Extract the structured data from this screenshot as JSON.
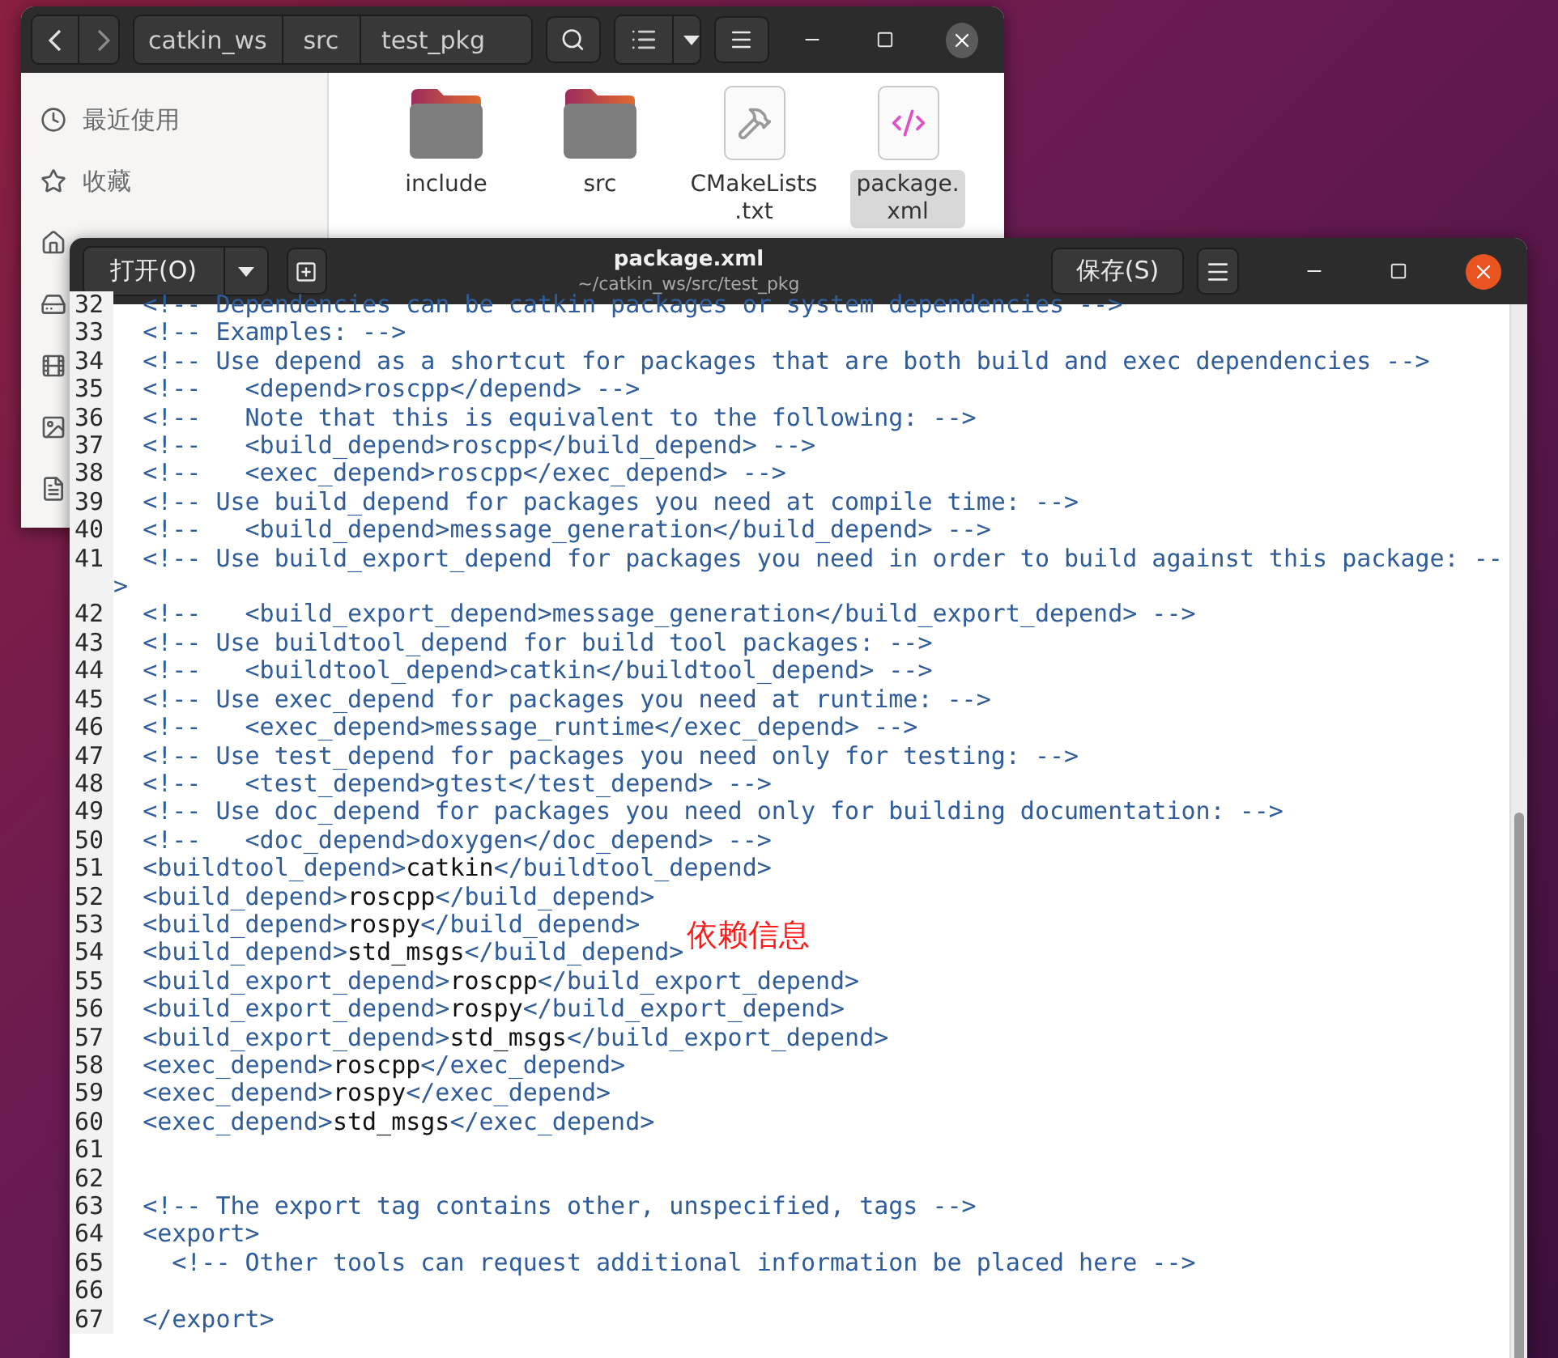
{
  "desktop": {
    "annotation": "依赖信息"
  },
  "file_manager": {
    "path": [
      {
        "label": "catkin_ws"
      },
      {
        "label": "src"
      },
      {
        "label": "test_pkg"
      }
    ],
    "sidebar": [
      {
        "label": "最近使用"
      },
      {
        "label": "收藏"
      }
    ],
    "files": [
      {
        "name": [
          "include"
        ],
        "kind": "folder",
        "selected": false
      },
      {
        "name": [
          "src"
        ],
        "kind": "folder",
        "selected": false
      },
      {
        "name": [
          "CMakeLists",
          ".txt"
        ],
        "kind": "build",
        "selected": false
      },
      {
        "name": [
          "package.",
          "xml"
        ],
        "kind": "xml",
        "selected": true
      }
    ]
  },
  "editor": {
    "open_button": "打开(O)",
    "title": "package.xml",
    "subtitle": "~/catkin_ws/src/test_pkg",
    "save_button": "保存(S)",
    "lines": [
      {
        "number": "32",
        "segments": [
          {
            "text": "  <!-- Dependencies can be catkin packages or system dependencies -->",
            "kind": "markup"
          }
        ]
      },
      {
        "number": "33",
        "segments": [
          {
            "text": "  <!-- Examples: -->",
            "kind": "markup"
          }
        ]
      },
      {
        "number": "34",
        "segments": [
          {
            "text": "  <!-- Use depend as a shortcut for packages that are both build and exec dependencies -->",
            "kind": "markup"
          }
        ]
      },
      {
        "number": "35",
        "segments": [
          {
            "text": "  <!--   <depend>roscpp</depend> -->",
            "kind": "markup"
          }
        ]
      },
      {
        "number": "36",
        "segments": [
          {
            "text": "  <!--   Note that this is equivalent to the following: -->",
            "kind": "markup"
          }
        ]
      },
      {
        "number": "37",
        "segments": [
          {
            "text": "  <!--   <build_depend>roscpp</build_depend> -->",
            "kind": "markup"
          }
        ]
      },
      {
        "number": "38",
        "segments": [
          {
            "text": "  <!--   <exec_depend>roscpp</exec_depend> -->",
            "kind": "markup"
          }
        ]
      },
      {
        "number": "39",
        "segments": [
          {
            "text": "  <!-- Use build_depend for packages you need at compile time: -->",
            "kind": "markup"
          }
        ]
      },
      {
        "number": "40",
        "segments": [
          {
            "text": "  <!--   <build_depend>message_generation</build_depend> -->",
            "kind": "markup"
          }
        ]
      },
      {
        "number": "41",
        "segments": [
          {
            "text": "  <!-- Use build_export_depend for packages you need in order to build against this package: -->",
            "kind": "markup"
          }
        ]
      },
      {
        "number": "42",
        "segments": [
          {
            "text": "  <!--   <build_export_depend>message_generation</build_export_depend> -->",
            "kind": "markup"
          }
        ]
      },
      {
        "number": "43",
        "segments": [
          {
            "text": "  <!-- Use buildtool_depend for build tool packages: -->",
            "kind": "markup"
          }
        ]
      },
      {
        "number": "44",
        "segments": [
          {
            "text": "  <!--   <buildtool_depend>catkin</buildtool_depend> -->",
            "kind": "markup"
          }
        ]
      },
      {
        "number": "45",
        "segments": [
          {
            "text": "  <!-- Use exec_depend for packages you need at runtime: -->",
            "kind": "markup"
          }
        ]
      },
      {
        "number": "46",
        "segments": [
          {
            "text": "  <!--   <exec_depend>message_runtime</exec_depend> -->",
            "kind": "markup"
          }
        ]
      },
      {
        "number": "47",
        "segments": [
          {
            "text": "  <!-- Use test_depend for packages you need only for testing: -->",
            "kind": "markup"
          }
        ]
      },
      {
        "number": "48",
        "segments": [
          {
            "text": "  <!--   <test_depend>gtest</test_depend> -->",
            "kind": "markup"
          }
        ]
      },
      {
        "number": "49",
        "segments": [
          {
            "text": "  <!-- Use doc_depend for packages you need only for building documentation: -->",
            "kind": "markup"
          }
        ]
      },
      {
        "number": "50",
        "segments": [
          {
            "text": "  <!--   <doc_depend>doxygen</doc_depend> -->",
            "kind": "markup"
          }
        ]
      },
      {
        "number": "51",
        "segments": [
          {
            "text": "  <buildtool_depend>",
            "kind": "markup"
          },
          {
            "text": "catkin",
            "kind": "text"
          },
          {
            "text": "</buildtool_depend>",
            "kind": "markup"
          }
        ]
      },
      {
        "number": "52",
        "segments": [
          {
            "text": "  <build_depend>",
            "kind": "markup"
          },
          {
            "text": "roscpp",
            "kind": "text"
          },
          {
            "text": "</build_depend>",
            "kind": "markup"
          }
        ]
      },
      {
        "number": "53",
        "segments": [
          {
            "text": "  <build_depend>",
            "kind": "markup"
          },
          {
            "text": "rospy",
            "kind": "text"
          },
          {
            "text": "</build_depend>",
            "kind": "markup"
          }
        ]
      },
      {
        "number": "54",
        "segments": [
          {
            "text": "  <build_depend>",
            "kind": "markup"
          },
          {
            "text": "std_msgs",
            "kind": "text"
          },
          {
            "text": "</build_depend>",
            "kind": "markup"
          }
        ]
      },
      {
        "number": "55",
        "segments": [
          {
            "text": "  <build_export_depend>",
            "kind": "markup"
          },
          {
            "text": "roscpp",
            "kind": "text"
          },
          {
            "text": "</build_export_depend>",
            "kind": "markup"
          }
        ]
      },
      {
        "number": "56",
        "segments": [
          {
            "text": "  <build_export_depend>",
            "kind": "markup"
          },
          {
            "text": "rospy",
            "kind": "text"
          },
          {
            "text": "</build_export_depend>",
            "kind": "markup"
          }
        ]
      },
      {
        "number": "57",
        "segments": [
          {
            "text": "  <build_export_depend>",
            "kind": "markup"
          },
          {
            "text": "std_msgs",
            "kind": "text"
          },
          {
            "text": "</build_export_depend>",
            "kind": "markup"
          }
        ]
      },
      {
        "number": "58",
        "segments": [
          {
            "text": "  <exec_depend>",
            "kind": "markup"
          },
          {
            "text": "roscpp",
            "kind": "text"
          },
          {
            "text": "</exec_depend>",
            "kind": "markup"
          }
        ]
      },
      {
        "number": "59",
        "segments": [
          {
            "text": "  <exec_depend>",
            "kind": "markup"
          },
          {
            "text": "rospy",
            "kind": "text"
          },
          {
            "text": "</exec_depend>",
            "kind": "markup"
          }
        ]
      },
      {
        "number": "60",
        "segments": [
          {
            "text": "  <exec_depend>",
            "kind": "markup"
          },
          {
            "text": "std_msgs",
            "kind": "text"
          },
          {
            "text": "</exec_depend>",
            "kind": "markup"
          }
        ]
      },
      {
        "number": "61"
      },
      {
        "number": "62"
      },
      {
        "number": "63",
        "segments": [
          {
            "text": "  <!-- The export tag contains other, unspecified, tags -->",
            "kind": "markup"
          }
        ]
      },
      {
        "number": "64",
        "segments": [
          {
            "text": "  <export>",
            "kind": "markup"
          }
        ]
      },
      {
        "number": "65",
        "segments": [
          {
            "text": "    <!-- Other tools can request additional information be placed here -->",
            "kind": "markup"
          }
        ]
      },
      {
        "number": "66"
      },
      {
        "number": "67",
        "segments": [
          {
            "text": "  </export>",
            "kind": "markup"
          }
        ]
      }
    ]
  }
}
